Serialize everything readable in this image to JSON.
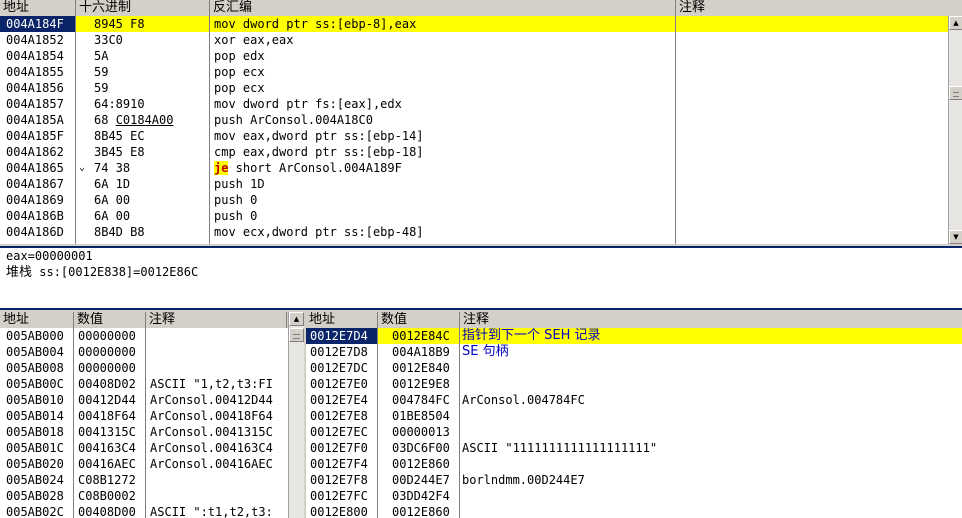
{
  "disasm": {
    "headers": [
      "地址",
      "十六进制",
      "反汇编",
      "注释"
    ],
    "rows": [
      {
        "addr": "004A184F",
        "hex": "8945 F8",
        "asm": "mov dword ptr ss:[ebp-8],eax",
        "selected": true
      },
      {
        "addr": "004A1852",
        "hex": "33C0",
        "asm": "xor eax,eax"
      },
      {
        "addr": "004A1854",
        "hex": "5A",
        "asm": "pop edx"
      },
      {
        "addr": "004A1855",
        "hex": "59",
        "asm": "pop ecx"
      },
      {
        "addr": "004A1856",
        "hex": "59",
        "asm": "pop ecx"
      },
      {
        "addr": "004A1857",
        "hex": "64:8910",
        "asm": "mov dword ptr fs:[eax],edx"
      },
      {
        "addr": "004A185A",
        "hex": "68 C0184A00",
        "asm": "push ArConsol.004A18C0"
      },
      {
        "addr": "004A185F",
        "hex": "8B45 EC",
        "asm": "mov eax,dword ptr ss:[ebp-14]"
      },
      {
        "addr": "004A1862",
        "hex": "3B45 E8",
        "asm": "cmp eax,dword ptr ss:[ebp-18]"
      },
      {
        "addr": "004A1865",
        "hex": "74 38",
        "asm_mnemonic": "je",
        "asm": " short ArConsol.004A189F",
        "jump_arrow": "⌄"
      },
      {
        "addr": "004A1867",
        "hex": "6A 1D",
        "asm": "push 1D"
      },
      {
        "addr": "004A1869",
        "hex": "6A 00",
        "asm": "push 0"
      },
      {
        "addr": "004A186B",
        "hex": "6A 00",
        "asm": "push 0"
      },
      {
        "addr": "004A186D",
        "hex": "8B4D B8",
        "asm": "mov ecx,dword ptr ss:[ebp-48]"
      }
    ]
  },
  "info": {
    "line1": "eax=00000001",
    "line2_prefix": "堆栈",
    "line2": " ss:[0012E838]=0012E86C"
  },
  "dump": {
    "headers": [
      "地址",
      "数值",
      "注释"
    ],
    "rows": [
      {
        "addr": "005AB000",
        "val": "00000000",
        "note": ""
      },
      {
        "addr": "005AB004",
        "val": "00000000",
        "note": ""
      },
      {
        "addr": "005AB008",
        "val": "00000000",
        "note": ""
      },
      {
        "addr": "005AB00C",
        "val": "00408D02",
        "note": "ASCII \"1,t2,t3:FI"
      },
      {
        "addr": "005AB010",
        "val": "00412D44",
        "note": "ArConsol.00412D44"
      },
      {
        "addr": "005AB014",
        "val": "00418F64",
        "note": "ArConsol.00418F64"
      },
      {
        "addr": "005AB018",
        "val": "0041315C",
        "note": "ArConsol.0041315C"
      },
      {
        "addr": "005AB01C",
        "val": "004163C4",
        "note": "ArConsol.004163C4"
      },
      {
        "addr": "005AB020",
        "val": "00416AEC",
        "note": "ArConsol.00416AEC"
      },
      {
        "addr": "005AB024",
        "val": "C08B1272",
        "note": ""
      },
      {
        "addr": "005AB028",
        "val": "C08B0002",
        "note": ""
      },
      {
        "addr": "005AB02C",
        "val": "00408D00",
        "note": "ASCII \":t1,t2,t3:"
      }
    ]
  },
  "stack": {
    "headers": [
      "地址",
      "数值",
      "注释"
    ],
    "rows": [
      {
        "addr": "0012E7D4",
        "val": "0012E84C",
        "note": "指针到下一个 SEH 记录",
        "selected": true,
        "cn": true
      },
      {
        "addr": "0012E7D8",
        "val": "004A18B9",
        "note": "SE 句柄",
        "cn": true
      },
      {
        "addr": "0012E7DC",
        "val": "0012E840",
        "note": ""
      },
      {
        "addr": "0012E7E0",
        "val": "0012E9E8",
        "note": ""
      },
      {
        "addr": "0012E7E4",
        "val": "004784FC",
        "note": "ArConsol.004784FC"
      },
      {
        "addr": "0012E7E8",
        "val": "01BE8504",
        "note": ""
      },
      {
        "addr": "0012E7EC",
        "val": "00000013",
        "note": ""
      },
      {
        "addr": "0012E7F0",
        "val": "03DC6F00",
        "note": "ASCII \"1111111111111111111\""
      },
      {
        "addr": "0012E7F4",
        "val": "0012E860",
        "note": ""
      },
      {
        "addr": "0012E7F8",
        "val": "00D244E7",
        "note": "borlndmm.00D244E7"
      },
      {
        "addr": "0012E7FC",
        "val": "03DD42F4",
        "note": ""
      },
      {
        "addr": "0012E800",
        "val": "0012E860",
        "note": ""
      }
    ]
  },
  "colors": {
    "selection_bg": "#ffff00",
    "address_cursor": "#0a246a",
    "jump_highlight": "#ffff00",
    "jump_text": "#c00000"
  }
}
